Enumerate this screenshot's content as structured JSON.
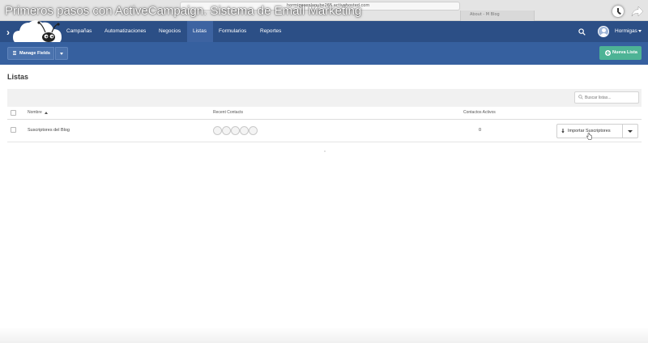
{
  "video": {
    "title": "Primeros pasos con ActiveCampaign. Sistema de Email Marketing"
  },
  "browser": {
    "url": "hormigasenlanube265.activehosted.com",
    "tab_title": "About - M Blog"
  },
  "nav": {
    "items": [
      {
        "label": "Campañas"
      },
      {
        "label": "Automatizaciones"
      },
      {
        "label": "Negocios"
      },
      {
        "label": "Listas"
      },
      {
        "label": "Formularios"
      },
      {
        "label": "Reportes"
      }
    ],
    "active": "Listas",
    "user_name": "Hormigas",
    "colors": {
      "primary": "#2c4f86",
      "active": "#3d63a1",
      "subbar": "#36609f"
    }
  },
  "toolbar": {
    "manage_fields": "Manage Fields",
    "new_list": "Nueva Lista",
    "new_list_color": "#4db395"
  },
  "page": {
    "title": "Listas",
    "search_placeholder": "Buscar listas..."
  },
  "table": {
    "columns": {
      "name": "Nombre",
      "recent": "Recent Contacts",
      "active": "Contactos Activos"
    },
    "rows": [
      {
        "name": "Suscriptores del Blog",
        "active_contacts": "0",
        "action": "Importar Suscriptores"
      }
    ]
  }
}
